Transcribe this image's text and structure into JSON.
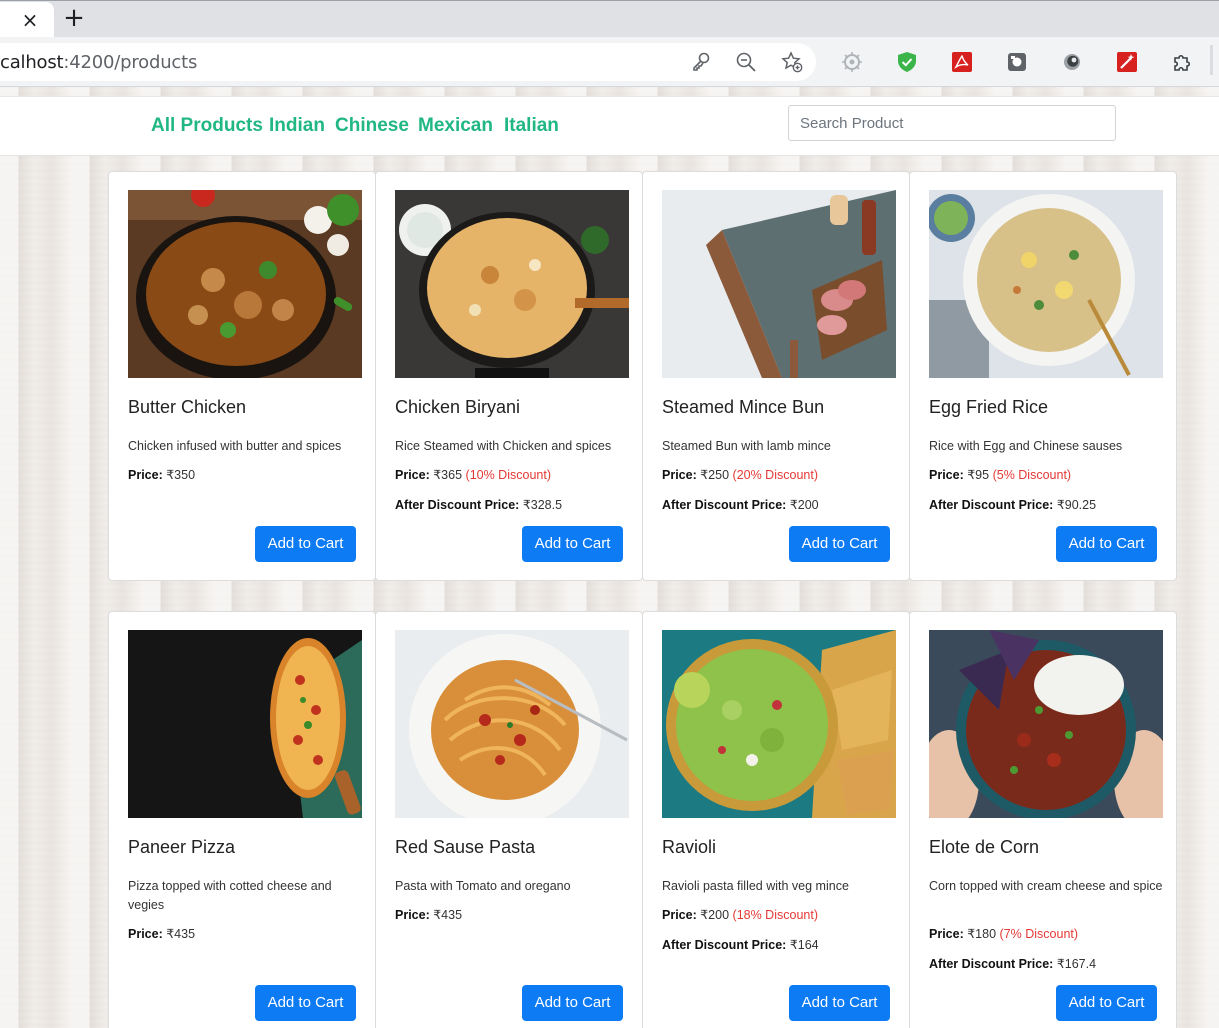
{
  "browser": {
    "tab_close": "×",
    "new_tab": "+",
    "url_host": "calhost",
    "url_path": ":4200/products",
    "icons": [
      "key-icon",
      "zoom-out-icon",
      "bookmark-add-icon",
      "gear-extension-icon",
      "shield-extension-icon",
      "pdf-extension-icon",
      "capture-extension-icon",
      "circle-extension-icon",
      "wand-extension-icon",
      "puzzle-extensions-icon"
    ]
  },
  "nav": {
    "links": [
      "All Products",
      "Indian",
      "Chinese",
      "Mexican",
      "Italian"
    ],
    "search_placeholder": "Search Product"
  },
  "labels": {
    "price": "Price:",
    "after_discount": "After Discount Price:",
    "add_to_cart": "Add to Cart"
  },
  "products": [
    {
      "name": "Butter Chicken",
      "description": "Chicken infused with butter and spices",
      "price": "₹350",
      "discount": "",
      "after": ""
    },
    {
      "name": "Chicken Biryani",
      "description": "Rice Steamed with Chicken and spices",
      "price": "₹365",
      "discount": "(10% Discount)",
      "after": "₹328.5"
    },
    {
      "name": "Steamed Mince Bun",
      "description": "Steamed Bun with lamb mince",
      "price": "₹250",
      "discount": "(20% Discount)",
      "after": "₹200"
    },
    {
      "name": "Egg Fried Rice",
      "description": "Rice with Egg and Chinese sauses",
      "price": "₹95",
      "discount": "(5% Discount)",
      "after": "₹90.25"
    },
    {
      "name": "Paneer Pizza",
      "description": "Pizza topped with cotted cheese and vegies",
      "price": "₹435",
      "discount": "",
      "after": ""
    },
    {
      "name": "Red Sause Pasta",
      "description": "Pasta with Tomato and oregano",
      "price": "₹435",
      "discount": "",
      "after": ""
    },
    {
      "name": "Ravioli",
      "description": "Ravioli pasta filled with veg mince",
      "price": "₹200",
      "discount": "(18% Discount)",
      "after": "₹164"
    },
    {
      "name": "Elote de Corn",
      "description": "Corn topped with cream cheese and spice",
      "price": "₹180",
      "discount": "(7% Discount)",
      "after": "₹167.4"
    }
  ],
  "colors": {
    "nav_link": "#20b783",
    "button": "#0d7bf3",
    "discount": "#e53935"
  }
}
